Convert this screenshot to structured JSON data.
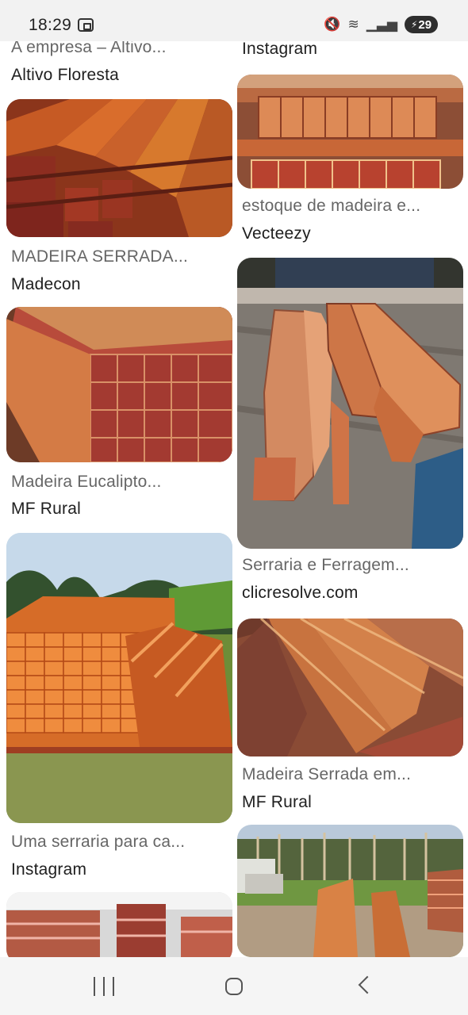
{
  "status": {
    "time": "18:29",
    "battery": "29",
    "icons": [
      "screen-record-icon",
      "mute-icon",
      "wifi-icon",
      "signal-icon",
      "charging-battery-icon"
    ]
  },
  "results": {
    "left": [
      {
        "title": "A empresa – Altivo...",
        "source": "Altivo Floresta"
      },
      {
        "title": "MADEIRA SERRADA...",
        "source": "Madecon"
      },
      {
        "title": "Madeira Eucalipto...",
        "source": "MF Rural"
      },
      {
        "title": "Uma serraria para ca...",
        "source": "Instagram"
      }
    ],
    "right": [
      {
        "title": "",
        "source": "Instagram"
      },
      {
        "title": "estoque de madeira e...",
        "source": "Vecteezy"
      },
      {
        "title": "Serraria e Ferragem...",
        "source": "clicresolve.com"
      },
      {
        "title": "Madeira Serrada em...",
        "source": "MF Rural"
      }
    ]
  },
  "navigation": {
    "buttons": [
      "recent-apps",
      "home",
      "back"
    ]
  }
}
